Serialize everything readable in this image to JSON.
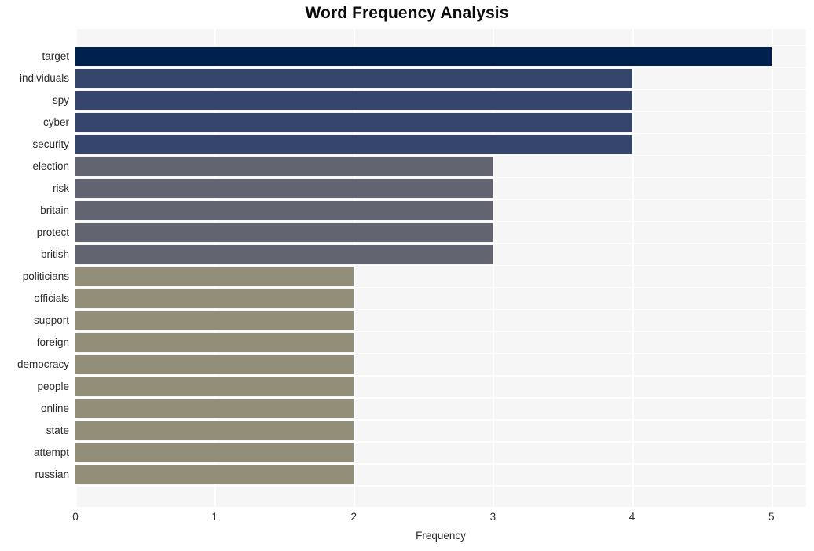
{
  "chart_data": {
    "type": "bar",
    "orientation": "horizontal",
    "title": "Word Frequency Analysis",
    "xlabel": "Frequency",
    "ylabel": "",
    "xlim": [
      0,
      5.25
    ],
    "xticks": [
      0,
      1,
      2,
      3,
      4,
      5
    ],
    "xtick_labels": [
      "0",
      "1",
      "2",
      "3",
      "4",
      "5"
    ],
    "grid": true,
    "grid_color": "#ffffff",
    "plot_background": "#f6f6f7",
    "legend": null,
    "categories": [
      "target",
      "individuals",
      "spy",
      "cyber",
      "security",
      "election",
      "risk",
      "britain",
      "protect",
      "british",
      "politicians",
      "officials",
      "support",
      "foreign",
      "democracy",
      "people",
      "online",
      "state",
      "attempt",
      "russian"
    ],
    "values": [
      5,
      4,
      4,
      4,
      4,
      3,
      3,
      3,
      3,
      3,
      2,
      2,
      2,
      2,
      2,
      2,
      2,
      2,
      2,
      2
    ],
    "bar_colors": [
      "#00214d",
      "#36456b",
      "#36456b",
      "#36456b",
      "#36456b",
      "#62656f",
      "#62656f",
      "#62656f",
      "#62656f",
      "#62656f",
      "#938e77",
      "#938e77",
      "#938e77",
      "#938e77",
      "#938e77",
      "#938e77",
      "#938e77",
      "#938e77",
      "#938e77",
      "#938e77"
    ]
  },
  "colors": {
    "title_text": "#0a0a0a",
    "axis_text": "#2b2b2b",
    "figure_background": "#ffffff"
  }
}
